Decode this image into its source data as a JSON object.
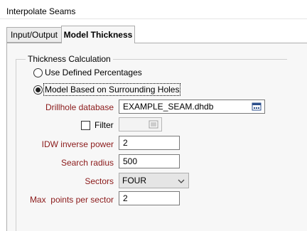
{
  "window": {
    "title": "Interpolate Seams"
  },
  "tabs": [
    {
      "label": "Input/Output",
      "active": false
    },
    {
      "label": "Model Thickness",
      "active": true
    }
  ],
  "thickness_calculation": {
    "group_label": "Thickness Calculation",
    "options": [
      {
        "label": "Use Defined Percentages",
        "selected": false
      },
      {
        "label": "Model Based on Surrounding Holes",
        "selected": true
      }
    ]
  },
  "fields": {
    "drillhole_database": {
      "label": "Drillhole database",
      "value": "EXAMPLE_SEAM.dhdb"
    },
    "filter": {
      "label": "Filter",
      "checked": false,
      "value": ""
    },
    "idw_inverse_power": {
      "label": "IDW inverse power",
      "value": "2"
    },
    "search_radius": {
      "label": "Search radius",
      "value": "500"
    },
    "sectors": {
      "label": "Sectors",
      "value": "FOUR"
    },
    "max_points_per_sector": {
      "label": "Max  points per sector",
      "value": "2"
    }
  },
  "colors": {
    "required_label": "#8b1a1a",
    "tab_active_bg": "#f7f7f7",
    "border": "#adadad"
  },
  "icons": {
    "browse": "browse-database-icon",
    "filter_browse": "filter-list-icon",
    "dropdown": "chevron-down-icon"
  }
}
